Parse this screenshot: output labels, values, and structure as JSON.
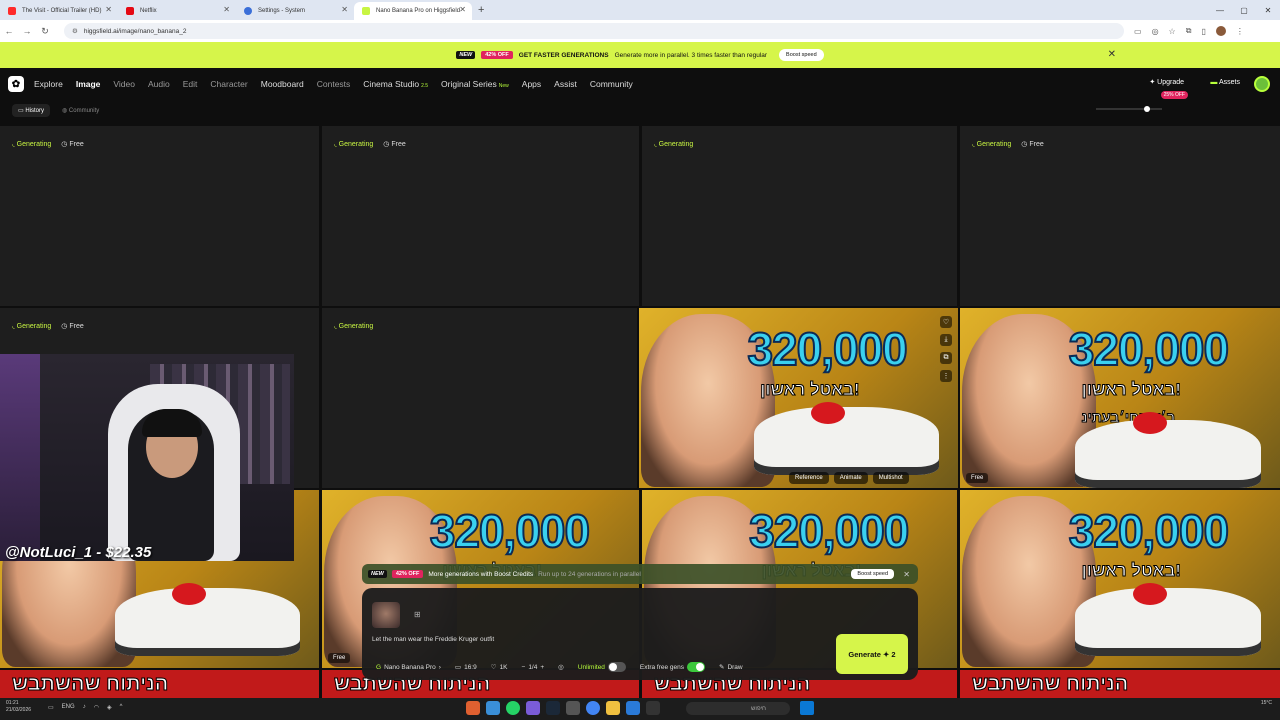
{
  "browser": {
    "tabs": [
      {
        "title": "The Visit - Official Trailer (HD)",
        "favicon": "youtube-icon",
        "color": "#ff2a2a"
      },
      {
        "title": "Netflix",
        "favicon": "netflix-icon",
        "color": "#e50914"
      },
      {
        "title": "Settings - System",
        "favicon": "gear-icon",
        "color": "#3b6fd8"
      },
      {
        "title": "Nano Banana Pro on Higgsfield",
        "favicon": "higgsfield-icon",
        "color": "#c8f542"
      }
    ],
    "url": "higgsfield.ai/image/nano_banana_2"
  },
  "banner": {
    "new": "NEW",
    "off": "42% OFF",
    "headline": "GET FASTER GENERATIONS",
    "text": "Generate more in parallel. 3 times faster than regular",
    "button": "Boost speed"
  },
  "nav": {
    "items": [
      "Explore",
      "Image",
      "Video",
      "Audio",
      "Edit",
      "Character",
      "Moodboard",
      "Contests",
      "Cinema Studio",
      "Original Series",
      "Apps",
      "Assist",
      "Community"
    ],
    "cinema_badge": "2.5",
    "series_badge": "New",
    "upgrade": "Upgrade",
    "upgrade_off": "25% OFF",
    "assets": "Assets"
  },
  "subnav": {
    "history": "History",
    "community": "Community"
  },
  "grid": {
    "generating": "Generating",
    "free": "Free",
    "thumb_number": "320,000",
    "thumb_hebrew": "באטל ראשון!",
    "thumb_hebrew_2": "ב׳צובחי׳בעתינ",
    "strip_text": "הניתוח שהשתבש",
    "actions": [
      "Reference",
      "Animate",
      "Multishot"
    ]
  },
  "webcam": {
    "label": "@NotLuci_1 - $22.35"
  },
  "promo": {
    "new": "NEW",
    "off": "42% OFF",
    "headline": "More generations with Boost Credits",
    "sub": "Run up to 24 generations in parallel",
    "button": "Boost speed"
  },
  "composer": {
    "prompt": "Let the man wear the Freddie Kruger outfit",
    "model": "Nano Banana Pro",
    "ratio": "16:9",
    "quality": "1K",
    "count": "1/4",
    "unlimited": "Unlimited",
    "extra": "Extra free gens",
    "draw": "Draw",
    "generate": "Generate",
    "generate_cost": "2"
  },
  "taskbar": {
    "time": "01:21",
    "date": "21/03/2026",
    "lang": "ENG",
    "search": "חיפוש",
    "weather": "15°C"
  }
}
